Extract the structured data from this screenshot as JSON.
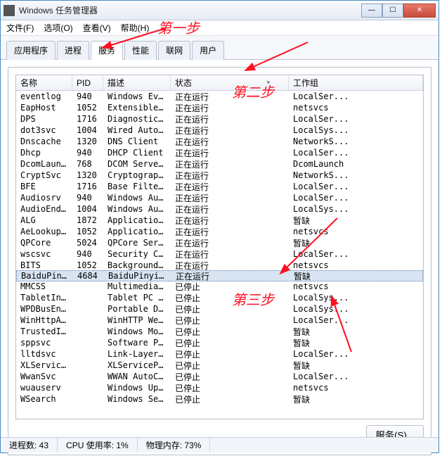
{
  "window": {
    "title": "Windows 任务管理器"
  },
  "menu": {
    "file": "文件(F)",
    "options": "选项(O)",
    "view": "查看(V)",
    "help": "帮助(H)"
  },
  "tabs": {
    "apps": "应用程序",
    "procs": "进程",
    "services": "服务",
    "perf": "性能",
    "net": "联网",
    "users": "用户"
  },
  "columns": {
    "name": "名称",
    "pid": "PID",
    "desc": "描述",
    "status": "状态",
    "group": "工作组"
  },
  "button": {
    "services": "服务(S)..."
  },
  "status": {
    "processes": "进程数: 43",
    "cpu": "CPU 使用率: 1%",
    "mem": "物理内存: 73%"
  },
  "annotations": {
    "step1": "第一步",
    "step2": "第二步",
    "step3": "第三步"
  },
  "rows": [
    {
      "name": "eventlog",
      "pid": "940",
      "desc": "Windows Ev...",
      "status": "正在运行",
      "group": "LocalSer..."
    },
    {
      "name": "EapHost",
      "pid": "1052",
      "desc": "Extensible...",
      "status": "正在运行",
      "group": "netsvcs"
    },
    {
      "name": "DPS",
      "pid": "1716",
      "desc": "Diagnostic...",
      "status": "正在运行",
      "group": "LocalSer..."
    },
    {
      "name": "dot3svc",
      "pid": "1004",
      "desc": "Wired Auto...",
      "status": "正在运行",
      "group": "LocalSys..."
    },
    {
      "name": "Dnscache",
      "pid": "1320",
      "desc": "DNS Client",
      "status": "正在运行",
      "group": "NetworkS..."
    },
    {
      "name": "Dhcp",
      "pid": "940",
      "desc": "DHCP Client",
      "status": "正在运行",
      "group": "LocalSer..."
    },
    {
      "name": "DcomLaunch",
      "pid": "768",
      "desc": "DCOM Serve...",
      "status": "正在运行",
      "group": "DcomLaunch"
    },
    {
      "name": "CryptSvc",
      "pid": "1320",
      "desc": "Cryptograp...",
      "status": "正在运行",
      "group": "NetworkS..."
    },
    {
      "name": "BFE",
      "pid": "1716",
      "desc": "Base Filte...",
      "status": "正在运行",
      "group": "LocalSer..."
    },
    {
      "name": "Audiosrv",
      "pid": "940",
      "desc": "Windows Audio",
      "status": "正在运行",
      "group": "LocalSer..."
    },
    {
      "name": "AudioEnd...",
      "pid": "1004",
      "desc": "Windows Au...",
      "status": "正在运行",
      "group": "LocalSys..."
    },
    {
      "name": "ALG",
      "pid": "1872",
      "desc": "Applicatio...",
      "status": "正在运行",
      "group": "暂缺"
    },
    {
      "name": "AeLookupSvc",
      "pid": "1052",
      "desc": "Applicatio...",
      "status": "正在运行",
      "group": "netsvcs"
    },
    {
      "name": "QPCore",
      "pid": "5024",
      "desc": "QPCore Ser...",
      "status": "正在运行",
      "group": "暂缺"
    },
    {
      "name": "wscsvc",
      "pid": "940",
      "desc": "Security C...",
      "status": "正在运行",
      "group": "LocalSer..."
    },
    {
      "name": "BITS",
      "pid": "1052",
      "desc": "Background...",
      "status": "正在运行",
      "group": "netsvcs"
    },
    {
      "name": "BaiduPin...",
      "pid": "4684",
      "desc": "BaiduPinyi...",
      "status": "正在运行",
      "group": "暂缺",
      "selected": true
    },
    {
      "name": "MMCSS",
      "pid": "",
      "desc": "Multimedia...",
      "status": "已停止",
      "group": "netsvcs"
    },
    {
      "name": "TabletIn...",
      "pid": "",
      "desc": "Tablet PC ...",
      "status": "已停止",
      "group": "LocalSys..."
    },
    {
      "name": "WPDBusEnum",
      "pid": "",
      "desc": "Portable D...",
      "status": "已停止",
      "group": "LocalSys..."
    },
    {
      "name": "WinHttpA...",
      "pid": "",
      "desc": "WinHTTP We...",
      "status": "已停止",
      "group": "LocalSer..."
    },
    {
      "name": "TrustedI...",
      "pid": "",
      "desc": "Windows Mo...",
      "status": "已停止",
      "group": "暂缺"
    },
    {
      "name": "sppsvc",
      "pid": "",
      "desc": "Software P...",
      "status": "已停止",
      "group": "暂缺"
    },
    {
      "name": "lltdsvc",
      "pid": "",
      "desc": "Link-Layer...",
      "status": "已停止",
      "group": "LocalSer..."
    },
    {
      "name": "XLServic...",
      "pid": "",
      "desc": "XLServiceP...",
      "status": "已停止",
      "group": "暂缺"
    },
    {
      "name": "WwanSvc",
      "pid": "",
      "desc": "WWAN AutoC...",
      "status": "已停止",
      "group": "LocalSer..."
    },
    {
      "name": "wuauserv",
      "pid": "",
      "desc": "Windows Up...",
      "status": "已停止",
      "group": "netsvcs"
    },
    {
      "name": "WSearch",
      "pid": "",
      "desc": "Windows Se...",
      "status": "已停止",
      "group": "暂缺"
    }
  ]
}
